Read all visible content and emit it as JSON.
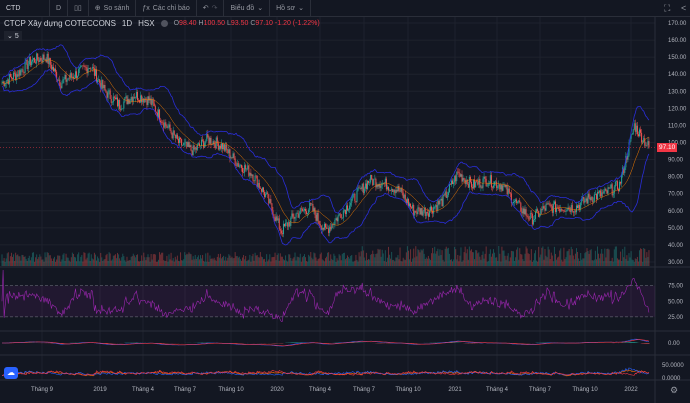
{
  "toolbar": {
    "symbol": "CTD",
    "interval": "D",
    "compare": "So sánh",
    "indicators": "Các chỉ báo",
    "chart_type": "Biểu đồ",
    "profile": "Hồ sơ"
  },
  "legend": {
    "title": "CTCP Xây dựng COTECCONS",
    "interval": "1D",
    "exchange": "HSX",
    "o_label": "O",
    "o": "98.40",
    "h_label": "H",
    "h": "100.50",
    "l_label": "L",
    "l": "93.50",
    "c_label": "C",
    "c": "97.10",
    "change": "-1.20 (-1.22%)",
    "indicator_count": "5"
  },
  "colors": {
    "background": "#131722",
    "up": "#26a69a",
    "down": "#ef5350",
    "bands": "#2a2ed8",
    "rsi": "#9c27b0",
    "macd": "#2962ff",
    "signal": "#f23645",
    "price_tag": "#f23645"
  },
  "chart_data": {
    "type": "candlestick",
    "title": "CTCP Xây dựng COTECCONS",
    "x": [
      "2018-06",
      "2018-07",
      "2018-08",
      "2018-09",
      "2018-10",
      "2018-11",
      "2018-12",
      "2019-01",
      "2019-02",
      "2019-03",
      "2019-04",
      "2019-05",
      "2019-06",
      "2019-07",
      "2019-08",
      "2019-09",
      "2019-10",
      "2019-11",
      "2019-12",
      "2020-01",
      "2020-02",
      "2020-03",
      "2020-04",
      "2020-05",
      "2020-06",
      "2020-07",
      "2020-08",
      "2020-09",
      "2020-10",
      "2020-11",
      "2020-12",
      "2021-01",
      "2021-02",
      "2021-03",
      "2021-04",
      "2021-05",
      "2021-06",
      "2021-07",
      "2021-08",
      "2021-09",
      "2021-10",
      "2021-11",
      "2021-12",
      "2022-01",
      "2022-02"
    ],
    "close": [
      135,
      140,
      148,
      150,
      135,
      140,
      145,
      130,
      122,
      128,
      125,
      112,
      100,
      95,
      102,
      98,
      88,
      82,
      68,
      48,
      58,
      62,
      48,
      58,
      68,
      78,
      76,
      72,
      60,
      60,
      66,
      82,
      75,
      78,
      75,
      64,
      55,
      62,
      62,
      62,
      68,
      70,
      75,
      110,
      97.1
    ],
    "last_price": "97.10",
    "time_ticks": [
      "Tháng 9",
      "2019",
      "Tháng 4",
      "Tháng 7",
      "Tháng 10",
      "2020",
      "Tháng 4",
      "Tháng 7",
      "Tháng 10",
      "2021",
      "Tháng 4",
      "Tháng 7",
      "Tháng 10",
      "2022"
    ],
    "price_ticks": [
      "170.00",
      "160.00",
      "150.00",
      "140.00",
      "130.00",
      "120.00",
      "110.00",
      "100.00",
      "90.00",
      "80.00",
      "70.00",
      "60.00",
      "50.00",
      "40.00",
      "30.00"
    ],
    "ylim": [
      30,
      170
    ],
    "rsi_ticks": [
      "75.00",
      "50.00",
      "25.00"
    ],
    "macd_ticks": [
      "0.00"
    ],
    "adx_ticks": [
      "50.0000",
      "0.0000"
    ],
    "grid": true
  }
}
